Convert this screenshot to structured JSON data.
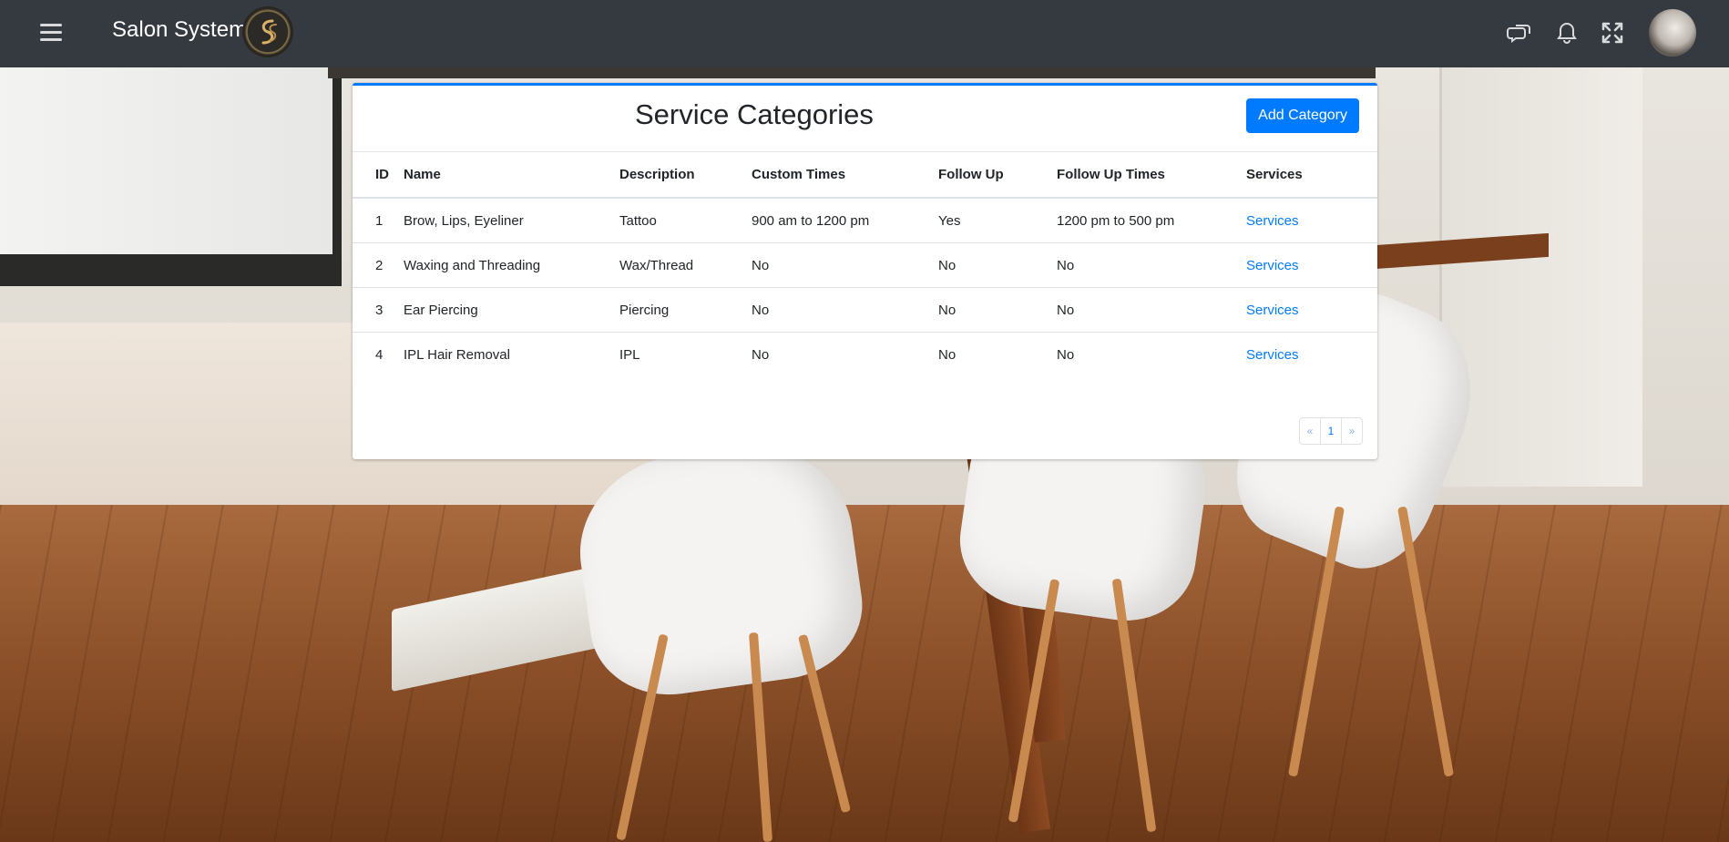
{
  "navbar": {
    "brand_text": "Salon System",
    "logo_glyph": "ꟍ",
    "icons": [
      "menu-icon",
      "chat-icon",
      "bell-icon",
      "expand-icon",
      "user-avatar"
    ],
    "bg_color": "#343a40"
  },
  "card": {
    "title": "Service Categories",
    "add_button": "Add Category",
    "accent": "#007bff"
  },
  "table": {
    "headers": [
      "ID",
      "Name",
      "Description",
      "Custom Times",
      "Follow Up",
      "Follow Up Times",
      "Services"
    ],
    "rows": [
      {
        "id": "1",
        "name": "Brow, Lips, Eyeliner",
        "description": "Tattoo",
        "custom_times": "900 am to 1200 pm",
        "follow_up": "Yes",
        "follow_up_times": "1200 pm to 500 pm",
        "services": "Services"
      },
      {
        "id": "2",
        "name": "Waxing and Threading",
        "description": "Wax/Thread",
        "custom_times": "No",
        "follow_up": "No",
        "follow_up_times": "No",
        "services": "Services"
      },
      {
        "id": "3",
        "name": "Ear Piercing",
        "description": "Piercing",
        "custom_times": "No",
        "follow_up": "No",
        "follow_up_times": "No",
        "services": "Services"
      },
      {
        "id": "4",
        "name": "IPL Hair Removal",
        "description": "IPL",
        "custom_times": "No",
        "follow_up": "No",
        "follow_up_times": "No",
        "services": "Services"
      }
    ]
  },
  "pagination": {
    "prev": "«",
    "current": "1",
    "next": "»"
  }
}
